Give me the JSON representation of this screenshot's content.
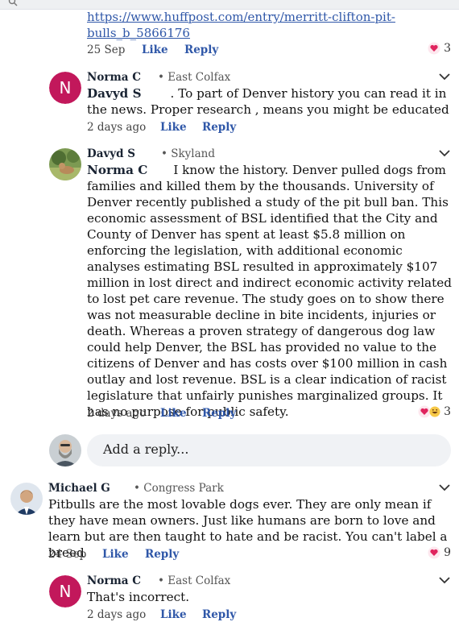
{
  "top_link": "https://www.huffpost.com/entry/merritt-clifton-pit-bulls_b_5866176",
  "first_meta": {
    "time": "25 Sep",
    "like": "Like",
    "reply": "Reply",
    "count": "3"
  },
  "comments": [
    {
      "name": "Norma C",
      "location": "• East Colfax",
      "mention": "Davyd S",
      "text": ".  To part of Denver history you can read it in the news. Proper research , means you might be educated",
      "time": "2 days ago",
      "like": "Like",
      "reply": "Reply"
    },
    {
      "name": "Davyd S",
      "location": "• Skyland",
      "mention": "Norma C",
      "text": "I know the history.  Denver pulled dogs from families and killed them by the thousands.  University of Denver recently published a study of the pit bull ban.   This economic assessment of BSL identified that the City and County of Denver has spent at least $5.8 million on enforcing the legislation, with additional economic analyses estimating BSL resulted in approximately $107 million in lost direct and indirect economic activity related to lost pet care revenue.  The study goes on to show there was not measurable decline in bite incidents, injuries or death.  Whereas a proven strategy of dangerous dog law could help Denver, the BSL has provided no value to the citizens of Denver and has costs over $100 million in cash outlay and lost revenue.  BSL is a clear indication of racist legislature that unfairly punishes marginalized groups.  It has no purpose for public safety.",
      "time": "2 days ago",
      "like": "Like",
      "reply": "Reply",
      "count": "3"
    },
    {
      "name": "Michael G",
      "location": "• Congress Park",
      "text": "Pitbulls are the most lovable dogs ever. They are only mean if they have mean owners. Just like humans are born to love and learn but are then taught to hate and be racist. You can't label a breed",
      "time": "24 Sep",
      "like": "Like",
      "reply": "Reply",
      "count": "9"
    },
    {
      "name": "Norma C",
      "location": "• East Colfax",
      "text": "That's incorrect.",
      "time": "2 days ago",
      "like": "Like",
      "reply": "Reply"
    }
  ],
  "add_reply_placeholder": "Add a reply...",
  "avatar_letter": "N",
  "colors": {
    "link": "#2f57a8",
    "avatar_n": "#c2185b",
    "heart": "#e0245e"
  }
}
